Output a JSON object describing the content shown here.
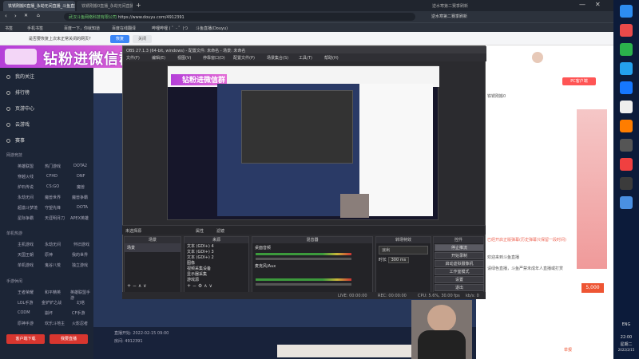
{
  "browser": {
    "tabs": [
      {
        "label": "铁锈刚搬0直播_永劫无间直播_斗鱼直播"
      },
      {
        "label": "铁锈刚搬0直播_永劫无间直播_斗鱼直播"
      },
      {
        "label": "逆水寒第二赛季刷新"
      }
    ],
    "url": "https://www.douyu.com/4912391",
    "site_name": "武汉斗鱼网络科技有限公司",
    "bookmarks": [
      "书签",
      "手机书签",
      "百度一下，你就知道",
      "百度在线翻译",
      "哔哩哔哩 ( ゜- ゜)つ",
      "有道",
      "B站",
      "斗鱼直播(Douyu)"
    ],
    "restore_bar": {
      "message": "是否要恢复上次未正常关闭的网页?",
      "restore_label": "恢复",
      "close_label": "关闭"
    }
  },
  "sidebar": {
    "items": [
      "我的关注",
      "排行榜",
      "页游中心",
      "云游戏",
      "赛事"
    ],
    "section_titles": [
      "网游竞技",
      "单机热游",
      "手游休闲"
    ],
    "grid_netgames": [
      "英雄联盟",
      "热门游戏",
      "DOTA2",
      "穿越火线",
      "CFHD",
      "DNF",
      "炉石传说",
      "CS:GO",
      "魔兽",
      "永劫无间",
      "魔兽世界",
      "魔兽争霸",
      "超激斗梦境",
      "守望先锋",
      "DOTA",
      "星际争霸",
      "天涯明月刀",
      "APEX英雄"
    ],
    "grid_single": [
      "主机游戏",
      "永劫无间",
      "怀旧游戏",
      "天国王朝",
      "原神",
      "我的世界",
      "单机游戏",
      "鬼谷八荒",
      "独立游戏"
    ],
    "grid_mobile": [
      "王者荣耀",
      "和平精英",
      "英雄联盟手游",
      "LOL手游",
      "金铲铲之战",
      "幻塔",
      "CODM",
      "崩坏",
      "CF手游",
      "原神手游",
      "欢乐斗地主",
      "火影忍者"
    ],
    "bottom_buttons": [
      "客户端下载",
      "我要直播"
    ]
  },
  "banner": {
    "title": "钻粉进微信群"
  },
  "obs": {
    "title": "OBS 27.1.3 (64-bit, windows) - 配置文件: 未命名 - 场景: 未命名",
    "menu": [
      "文件(F)",
      "编辑(E)",
      "视图(V)",
      "停靠窗口(D)",
      "配置文件(P)",
      "场景集合(S)",
      "工具(T)",
      "帮助(H)"
    ],
    "no_source": "未选择源",
    "props_label": "属性",
    "filters_label": "滤镜",
    "docks": {
      "scenes": {
        "header": "场景",
        "items": [
          "场景"
        ]
      },
      "sources": {
        "header": "来源",
        "items": [
          "文本 (GDI+) 4",
          "文本 (GDI+) 3",
          "文本 (GDI+) 2",
          "图像",
          "视频采集设备",
          "显示器采集",
          "游戏源"
        ]
      },
      "mixer": {
        "header": "混音器",
        "tracks": [
          "桌面音频",
          "麦克风/Aux"
        ]
      },
      "transitions": {
        "header": "转场特效",
        "type": "淡出",
        "duration_label": "时长",
        "duration": "300 ms"
      },
      "controls": {
        "header": "控件",
        "buttons": [
          "停止推流",
          "开始录制",
          "启动虚拟摄像机",
          "工作室模式",
          "设置",
          "退出"
        ]
      }
    },
    "status": {
      "live": "LIVE: 00:00:00",
      "rec": "REC: 00:00:00",
      "cpu": "CPU: 5.6%, 30.00 fps",
      "kb": "kb/s: 0"
    }
  },
  "page": {
    "stream_start": "直播开始: 2022-02-15 09:00",
    "room_info": "房间: 4912391",
    "room_name": "铁锈刚搬0",
    "follow_label": "关注",
    "pc_live": "PC客户端",
    "chat": [
      {
        "user": "系统提示",
        "text": "已经开启正版弹幕(历史弹幕只保留一段时间)"
      },
      {
        "user": "系统提示",
        "text": "欢迎来到斗鱼直播"
      },
      {
        "text": "请绿色直播，斗鱼严禁未成年人直播或打赏"
      }
    ],
    "gifts_count": "5,000",
    "report": "举报",
    "send": "发送"
  },
  "taskbar": {
    "time": "22:00",
    "weekday": "星期二",
    "date": "2022/2/15",
    "lang": "ENG"
  }
}
